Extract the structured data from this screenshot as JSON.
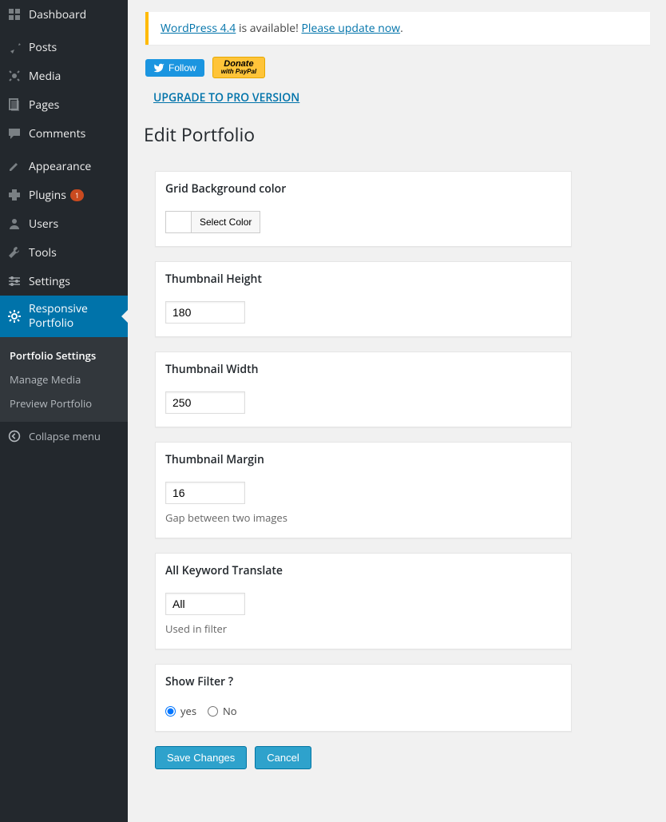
{
  "sidebar": {
    "items": [
      {
        "label": "Dashboard",
        "icon": "dashboard"
      },
      {
        "label": "Posts",
        "icon": "pin"
      },
      {
        "label": "Media",
        "icon": "media"
      },
      {
        "label": "Pages",
        "icon": "pages"
      },
      {
        "label": "Comments",
        "icon": "comments"
      },
      {
        "label": "Appearance",
        "icon": "appearance"
      },
      {
        "label": "Plugins",
        "icon": "plugins",
        "badge": "1"
      },
      {
        "label": "Users",
        "icon": "users"
      },
      {
        "label": "Tools",
        "icon": "tools"
      },
      {
        "label": "Settings",
        "icon": "settings"
      },
      {
        "label": "Responsive Portfolio",
        "icon": "gear",
        "active": true
      }
    ],
    "submenu": [
      {
        "label": "Portfolio Settings",
        "active": true
      },
      {
        "label": "Manage Media"
      },
      {
        "label": "Preview Portfolio"
      }
    ],
    "collapse": "Collapse menu"
  },
  "notice": {
    "link1": "WordPress 4.4",
    "text": " is available! ",
    "link2": "Please update now",
    "suffix": "."
  },
  "actions": {
    "follow": "Follow",
    "donate_line1": "Donate",
    "donate_line2": "with PayPal",
    "upgrade": "UPGRADE TO PRO VERSION"
  },
  "page_title": "Edit Portfolio",
  "fields": {
    "bg_color": {
      "title": "Grid Background color",
      "button": "Select Color"
    },
    "thumb_height": {
      "title": "Thumbnail Height",
      "value": "180"
    },
    "thumb_width": {
      "title": "Thumbnail Width",
      "value": "250"
    },
    "thumb_margin": {
      "title": "Thumbnail Margin",
      "value": "16",
      "helper": "Gap between two images"
    },
    "all_keyword": {
      "title": "All Keyword Translate",
      "value": "All",
      "helper": "Used in filter"
    },
    "show_filter": {
      "title": "Show Filter ?",
      "yes": "yes",
      "no": "No"
    }
  },
  "buttons": {
    "save": "Save Changes",
    "cancel": "Cancel"
  }
}
